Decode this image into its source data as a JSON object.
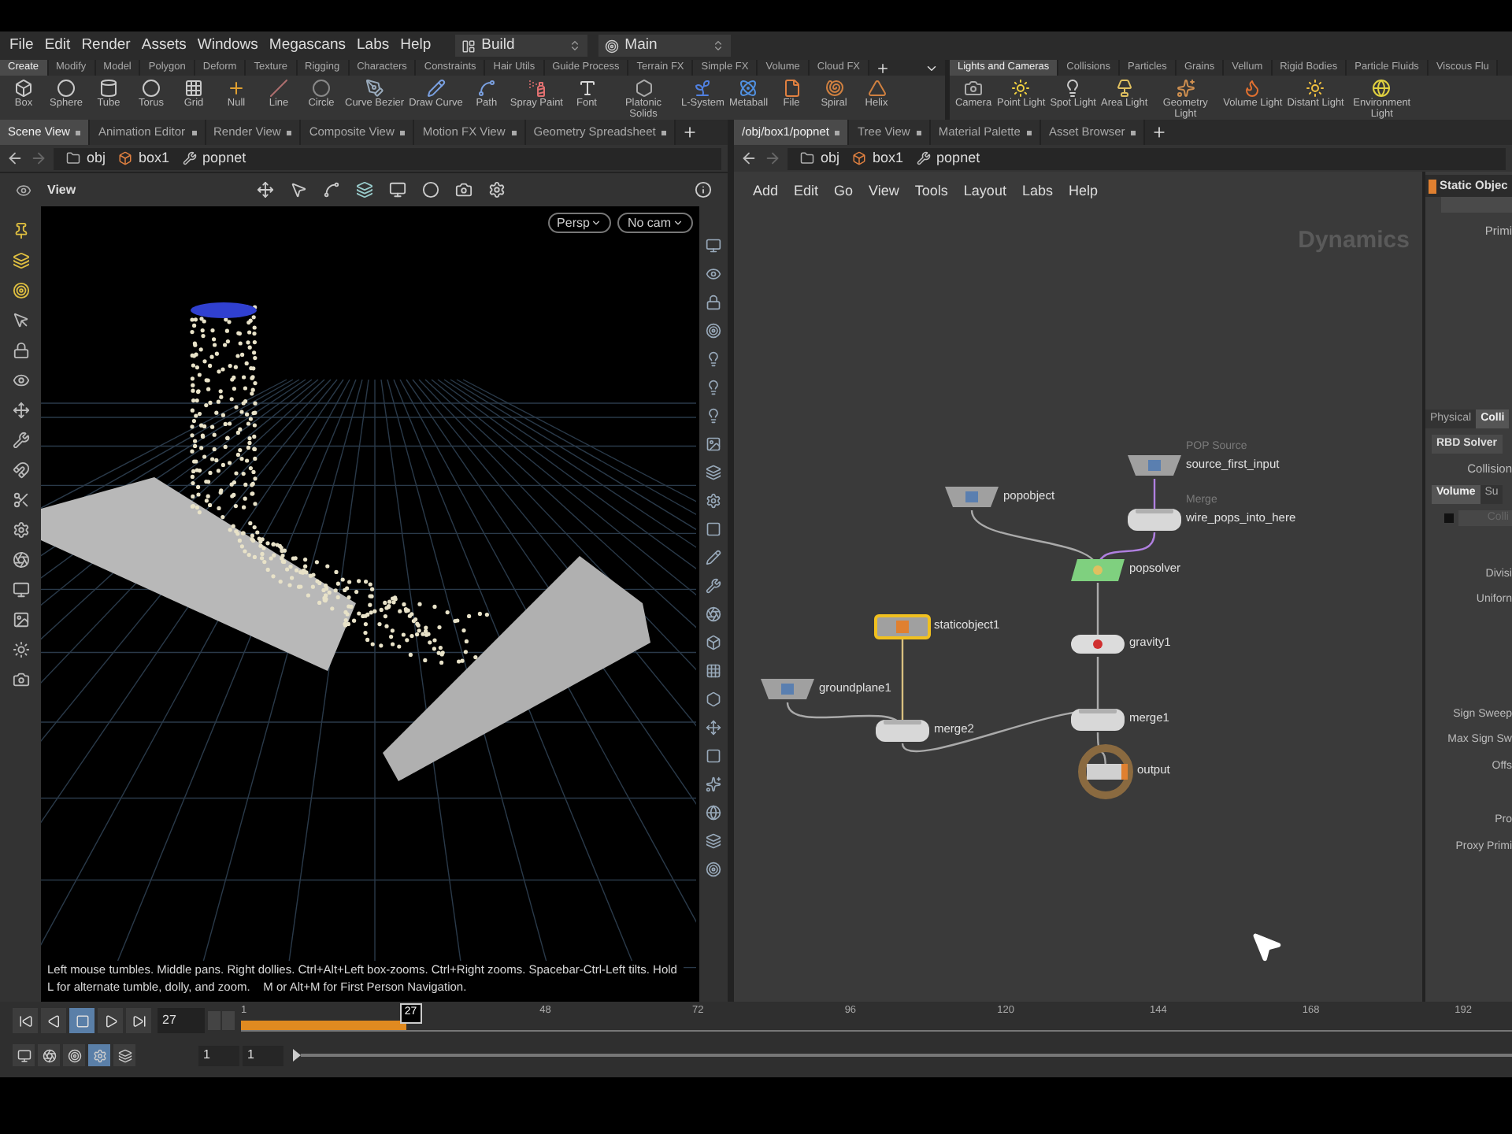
{
  "menu_bar": {
    "items": [
      "File",
      "Edit",
      "Render",
      "Assets",
      "Windows",
      "Megascans",
      "Labs",
      "Help"
    ],
    "desktop": "Build",
    "context": "Main"
  },
  "shelf_left": {
    "tabs": [
      {
        "label": "Create",
        "selected": true
      },
      {
        "label": "Modify",
        "selected": false
      },
      {
        "label": "Model",
        "selected": false
      },
      {
        "label": "Polygon",
        "selected": false
      },
      {
        "label": "Deform",
        "selected": false
      },
      {
        "label": "Texture",
        "selected": false
      },
      {
        "label": "Rigging",
        "selected": false
      },
      {
        "label": "Characters",
        "selected": false
      },
      {
        "label": "Constraints",
        "selected": false
      },
      {
        "label": "Hair Utils",
        "selected": false
      },
      {
        "label": "Guide Process",
        "selected": false
      },
      {
        "label": "Terrain FX",
        "selected": false
      },
      {
        "label": "Simple FX",
        "selected": false
      },
      {
        "label": "Volume",
        "selected": false
      },
      {
        "label": "Cloud FX",
        "selected": false
      }
    ],
    "tools": [
      "Box",
      "Sphere",
      "Tube",
      "Torus",
      "Grid",
      "Null",
      "Line",
      "Circle",
      "Curve Bezier",
      "Draw Curve",
      "Path",
      "Spray Paint",
      "Font",
      "Platonic Solids",
      "L-System",
      "Metaball",
      "File",
      "Spiral",
      "Helix"
    ]
  },
  "shelf_right": {
    "tabs": [
      {
        "label": "Lights and Cameras",
        "selected": true
      },
      {
        "label": "Collisions",
        "selected": false
      },
      {
        "label": "Particles",
        "selected": false
      },
      {
        "label": "Grains",
        "selected": false
      },
      {
        "label": "Vellum",
        "selected": false
      },
      {
        "label": "Rigid Bodies",
        "selected": false
      },
      {
        "label": "Particle Fluids",
        "selected": false
      },
      {
        "label": "Viscous Flu",
        "selected": false
      }
    ],
    "tools": [
      "Camera",
      "Point Light",
      "Spot Light",
      "Area Light",
      "Geometry Light",
      "Volume Light",
      "Distant Light",
      "Environment Light"
    ]
  },
  "scene_pane": {
    "tabs": [
      {
        "label": "Scene View",
        "selected": true
      },
      {
        "label": "Animation Editor",
        "selected": false
      },
      {
        "label": "Render View",
        "selected": false
      },
      {
        "label": "Composite View",
        "selected": false
      },
      {
        "label": "Motion FX View",
        "selected": false
      },
      {
        "label": "Geometry Spreadsheet",
        "selected": false
      }
    ],
    "path": [
      "obj",
      "box1",
      "popnet"
    ],
    "viewport": {
      "label": "View",
      "camera_buttons": [
        "Persp",
        "No cam"
      ],
      "hint": "Left mouse tumbles. Middle pans. Right dollies. Ctrl+Alt+Left box-zooms. Ctrl+Right zooms. Spacebar-Ctrl-Left tilts. Hold L for alternate tumble, dolly, and zoom.    M or Alt+M for First Person Navigation."
    }
  },
  "network_pane": {
    "tabs": [
      {
        "label": "/obj/box1/popnet",
        "selected": true
      },
      {
        "label": "Tree View",
        "selected": false
      },
      {
        "label": "Material Palette",
        "selected": false
      },
      {
        "label": "Asset Browser",
        "selected": false
      }
    ],
    "path": [
      "obj",
      "box1",
      "popnet"
    ],
    "menu": [
      "Add",
      "Edit",
      "Go",
      "View",
      "Tools",
      "Layout",
      "Labs",
      "Help"
    ],
    "context_label": "Dynamics",
    "nodes": [
      {
        "label": "source_first_input",
        "sublabel": "POP Source",
        "kind": "object",
        "selected": false
      },
      {
        "label": "popobject",
        "kind": "object",
        "selected": false
      },
      {
        "label": "wire_pops_into_here",
        "sublabel": "Merge",
        "kind": "merge",
        "selected": false
      },
      {
        "label": "popsolver",
        "kind": "solver",
        "selected": false
      },
      {
        "label": "staticobject1",
        "kind": "static",
        "selected": true
      },
      {
        "label": "gravity1",
        "kind": "force",
        "selected": false
      },
      {
        "label": "groundplane1",
        "kind": "object",
        "selected": false
      },
      {
        "label": "merge1",
        "kind": "merge",
        "selected": false
      },
      {
        "label": "merge2",
        "kind": "merge",
        "selected": false
      },
      {
        "label": "output",
        "kind": "output",
        "selected": false
      }
    ]
  },
  "parameters": {
    "title": "Static Objec",
    "field_label": "Primi",
    "tabs": [
      {
        "label": "Physical",
        "selected": false
      },
      {
        "label": "Colli",
        "selected": true
      }
    ],
    "solver_button": "RBD Solver",
    "collision_label": "Collision",
    "subtabs": [
      {
        "label": "Volume",
        "selected": true
      },
      {
        "label": "Su",
        "selected": false
      }
    ],
    "toggle": {
      "label": "Colli",
      "checked": false,
      "disabled": true
    },
    "labels": [
      "Divisi",
      "Uniforn",
      "Sign Sweep",
      "Max Sign Sw",
      "Offs",
      "Pro",
      "Proxy Primi"
    ]
  },
  "timeline": {
    "frame": "27",
    "marker": "27",
    "level": 0.13,
    "ticks": [
      "1",
      "48",
      "72",
      "96",
      "120",
      "144",
      "168",
      "192"
    ],
    "range_fields": [
      "1",
      "1"
    ]
  }
}
